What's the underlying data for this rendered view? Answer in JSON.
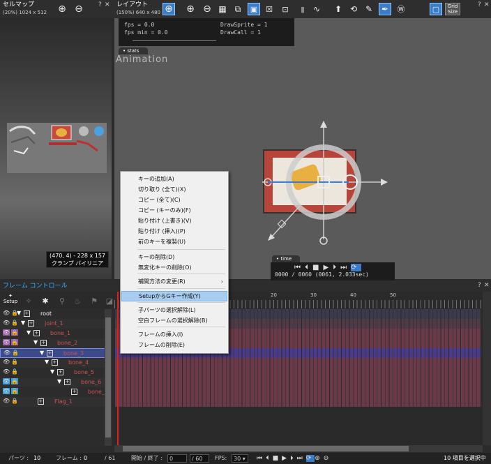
{
  "cellmap": {
    "title": "セルマップ",
    "sub": "(20%) 1024 x 512",
    "coords": "(470, 4) - 228 x 157",
    "filters": "クランプ  バイリニア"
  },
  "layout": {
    "title": "レイアウト",
    "sub": "(150%) 640 x 480"
  },
  "stats": {
    "fps": "fps = 0.0",
    "fps_min": "fps min = 0.0",
    "drawsprite": "DrawSprite = 1",
    "drawcall": "DrawCall = 1",
    "tab": "stats"
  },
  "canvas_label": "Animation",
  "time": {
    "tab": "time",
    "readout": "0000 / 0060 (0061, 2.033sec)"
  },
  "toolbar": {
    "grid_label": "Grid\nSize",
    "help": "?",
    "close": "✕"
  },
  "context_menu": {
    "items": [
      "キーの追加(A)",
      "切り取り (全て)(X)",
      "コピー (全て)(C)",
      "コピー (キーのみ)(F)",
      "貼り付け (上書き)(V)",
      "貼り付け (挿入)(P)",
      "前のキーを複製(U)",
      "キーの削除(D)",
      "無変化キーの削除(O)",
      "補間方法の変更(R)",
      "SetupからGキー作成(Y)",
      "子パーツの選択解除(L)",
      "空白フレームの選択解除(B)",
      "フレームの挿入(I)",
      "フレームの削除(E)"
    ]
  },
  "frame_control": {
    "title": "フレーム コントロール",
    "setup": "Setup",
    "tick20": "20",
    "tick30": "30",
    "tick40": "40",
    "tick50": "50"
  },
  "tree": [
    {
      "label": "root",
      "color": "#ffffff"
    },
    {
      "label": "joint_1",
      "color": "#d05050"
    },
    {
      "label": "bone_1",
      "color": "#d05050"
    },
    {
      "label": "bone_2",
      "color": "#d05050"
    },
    {
      "label": "bone_3",
      "color": "#d05050"
    },
    {
      "label": "bone_4",
      "color": "#d05050"
    },
    {
      "label": "bone_5",
      "color": "#d05050"
    },
    {
      "label": "bone_6",
      "color": "#d05050"
    },
    {
      "label": "bone_7",
      "color": "#d05050"
    },
    {
      "label": "Flag_1",
      "color": "#d05050"
    }
  ],
  "status": {
    "parts_label": "パーツ : ",
    "parts": "10",
    "frame_label": "フレーム : ",
    "frame": "0",
    "frame_total": "/ 61",
    "startend_label": "開始 / 終了 : ",
    "start": "0",
    "end": "/ 60",
    "fps_label": "FPS: ",
    "fps": "30",
    "selected": "10 項目を選択中"
  }
}
